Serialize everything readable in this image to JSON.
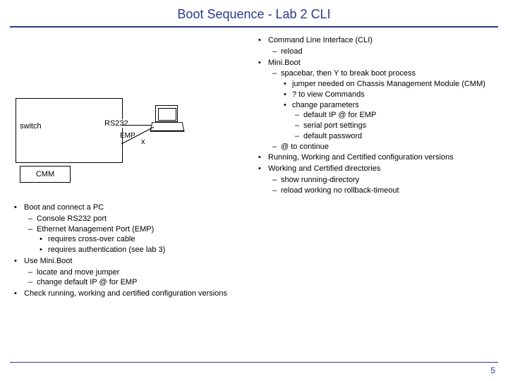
{
  "title": "Boot Sequence - Lab 2 CLI",
  "page_number": "5",
  "diagram": {
    "switch_label": "switch",
    "cmm_label": "CMM",
    "rs232_label": "RS232",
    "emp_label": "EMP",
    "x_mark": "x"
  },
  "left_bullets": [
    {
      "text": "Boot and connect a PC",
      "sub": [
        {
          "text": "Console RS232 port"
        },
        {
          "text": "Ethernet Management Port (EMP)",
          "sub": [
            {
              "text": "requires cross-over cable"
            },
            {
              "text": "requires authentication (see lab 3)"
            }
          ]
        }
      ]
    },
    {
      "text": "Use Mini.Boot",
      "sub": [
        {
          "text": "locate and move jumper"
        },
        {
          "text": "change default IP @ for EMP"
        }
      ]
    },
    {
      "text": "Check running, working and certified configuration versions"
    }
  ],
  "right_bullets": [
    {
      "text": "Command Line Interface (CLI)",
      "sub": [
        {
          "text": "reload"
        }
      ]
    },
    {
      "text": "Mini.Boot",
      "sub": [
        {
          "text": "spacebar, then Y to break boot process",
          "sub": [
            {
              "text": "jumper needed on Chassis Management Module (CMM)"
            },
            {
              "text": "? to view Commands"
            },
            {
              "text": "change parameters",
              "sub": [
                {
                  "text": "default IP @ for EMP"
                },
                {
                  "text": "serial port settings"
                },
                {
                  "text": "default password"
                }
              ]
            }
          ]
        },
        {
          "text": "@ to continue"
        }
      ]
    },
    {
      "text": "Running, Working and Certified configuration versions"
    },
    {
      "text": "Working and Certified directories",
      "sub": [
        {
          "text": "show running-directory"
        },
        {
          "text": "reload working no rollback-timeout"
        }
      ]
    }
  ]
}
